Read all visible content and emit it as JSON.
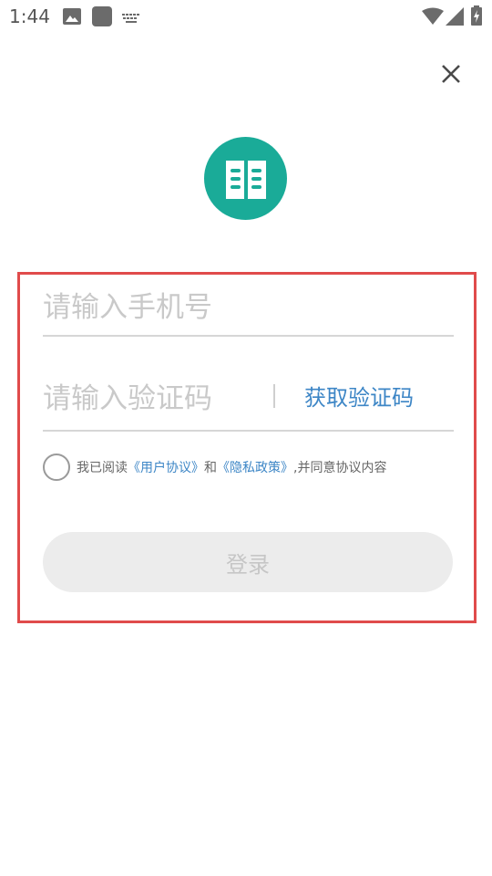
{
  "status_bar": {
    "time": "1:44",
    "icons": [
      "image-icon",
      "app-icon",
      "keyboard-icon",
      "wifi-icon",
      "signal-icon",
      "battery-charging-icon"
    ]
  },
  "close_icon": "close-icon",
  "logo_icon": "book-icon",
  "colors": {
    "logo_bg": "#1aab98",
    "link": "#3d86c6",
    "highlight_border": "#e04b4b",
    "button_bg": "#ececec"
  },
  "form": {
    "phone_placeholder": "请输入手机号",
    "phone_value": "",
    "code_placeholder": "请输入验证码",
    "code_value": "",
    "get_code_label": "获取验证码",
    "agreement": {
      "prefix": "我已阅读",
      "user_agreement": "《用户协议》",
      "and": "和",
      "privacy_policy": "《隐私政策》",
      "suffix": ",并同意协议内容",
      "checked": false
    },
    "login_label": "登录"
  }
}
